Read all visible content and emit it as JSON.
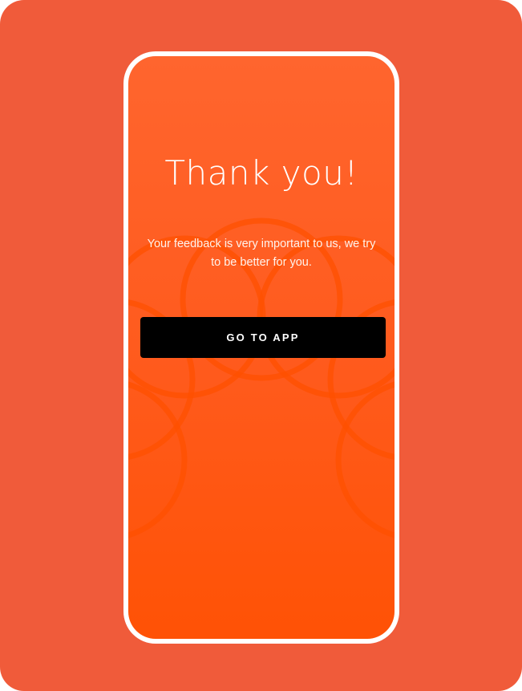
{
  "screen": {
    "title": "Thank you!",
    "message": "Your feedback is very important to us, we try to be better for you.",
    "primary_button_label": "GO TO APP"
  },
  "colors": {
    "background": "#f05b3a",
    "phone_frame": "#ffffff",
    "screen_gradient_top": "#ff652e",
    "screen_gradient_bottom": "#ff5205",
    "pattern_stroke": "#ff5000",
    "button_background": "#000000",
    "button_text": "#ffffff",
    "text": "#ffffff"
  },
  "icons": {
    "pattern": "overlapping-circles-pattern"
  }
}
